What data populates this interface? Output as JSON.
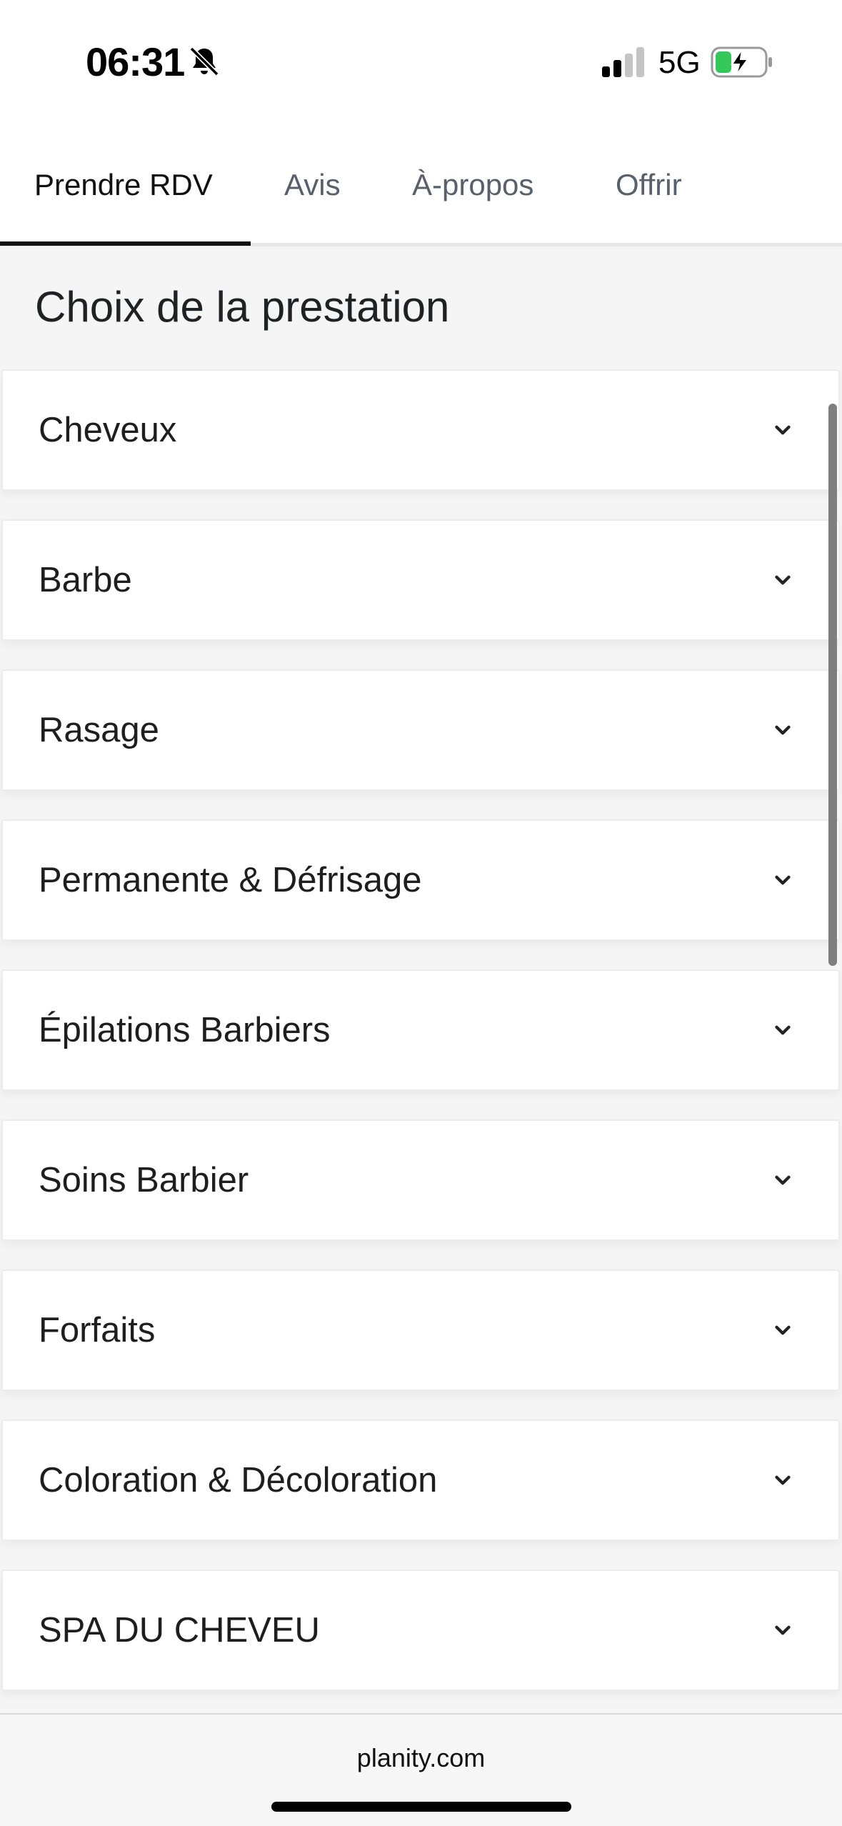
{
  "status_bar": {
    "time": "06:31",
    "network": "5G",
    "icons": [
      "bell-slash-icon",
      "signal-icon",
      "battery-charging-icon"
    ]
  },
  "tabs": [
    {
      "label": "Prendre RDV",
      "active": true
    },
    {
      "label": "Avis",
      "active": false
    },
    {
      "label": "À-propos",
      "active": false
    },
    {
      "label": "Offrir",
      "active": false
    }
  ],
  "section_title": "Choix de la prestation",
  "categories": [
    {
      "label": "Cheveux",
      "icon": "chevron-down-icon"
    },
    {
      "label": "Barbe",
      "icon": "chevron-down-icon"
    },
    {
      "label": "Rasage",
      "icon": "chevron-down-icon"
    },
    {
      "label": "Permanente & Défrisage",
      "icon": "chevron-down-icon"
    },
    {
      "label": "Épilations Barbiers",
      "icon": "chevron-down-icon"
    },
    {
      "label": "Soins Barbier",
      "icon": "chevron-down-icon"
    },
    {
      "label": "Forfaits",
      "icon": "chevron-down-icon"
    },
    {
      "label": "Coloration & Décoloration",
      "icon": "chevron-down-icon"
    },
    {
      "label": "SPA DU CHEVEU",
      "icon": "chevron-down-icon"
    }
  ],
  "browser": {
    "url": "planity.com"
  },
  "colors": {
    "active_tab": "#111111",
    "inactive_tab": "#59606b",
    "background": "#f5f5f5",
    "battery_charge": "#34c759"
  }
}
